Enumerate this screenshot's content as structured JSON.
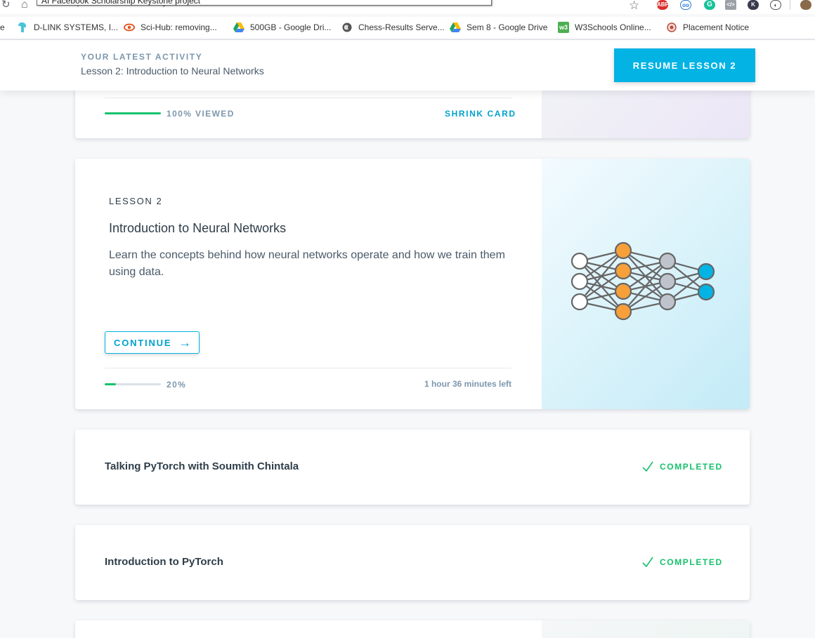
{
  "browser": {
    "tooltip": "AI Facebook Scholarship Keystone project",
    "url": "https://classroom.udacity.com/courses/ud188",
    "bookmarks": [
      {
        "label": "D-LINK SYSTEMS, I...",
        "icon": "tp-link-icon"
      },
      {
        "label": "Sci-Hub: removing...",
        "icon": "sci-hub-icon"
      },
      {
        "label": "500GB - Google Dri...",
        "icon": "google-drive-icon"
      },
      {
        "label": "Chess-Results Serve...",
        "icon": "globe-icon"
      },
      {
        "label": "Sem 8 - Google Drive",
        "icon": "google-drive-icon"
      },
      {
        "label": "W3Schools Online...",
        "icon": "w3schools-icon"
      },
      {
        "label": "Placement Notice",
        "icon": "college-seal-icon"
      }
    ],
    "truncated_left": "e"
  },
  "header": {
    "activity_label": "YOUR LATEST ACTIVITY",
    "activity_title": "Lesson 2: Introduction to Neural Networks",
    "resume_label": "RESUME LESSON 2"
  },
  "card_prev": {
    "progress_text": "100% VIEWED",
    "progress": 1.0,
    "shrink_label": "SHRINK CARD"
  },
  "lesson": {
    "label": "LESSON 2",
    "title": "Introduction to Neural Networks",
    "description": "Learn the concepts behind how neural networks operate and how we train them using data.",
    "continue_label": "CONTINUE",
    "progress_text": "20%",
    "progress": 0.2,
    "time_left": "1 hour 36 minutes left"
  },
  "concepts": [
    {
      "title": "Talking PyTorch with Soumith Chintala",
      "status": "COMPLETED"
    },
    {
      "title": "Introduction to PyTorch",
      "status": "COMPLETED"
    }
  ],
  "colors": {
    "accent": "#02b3e4",
    "success": "#15c26b",
    "node_orange": "#f7a03a",
    "node_gray": "#bfc4cc",
    "node_blue": "#02b3e4"
  }
}
